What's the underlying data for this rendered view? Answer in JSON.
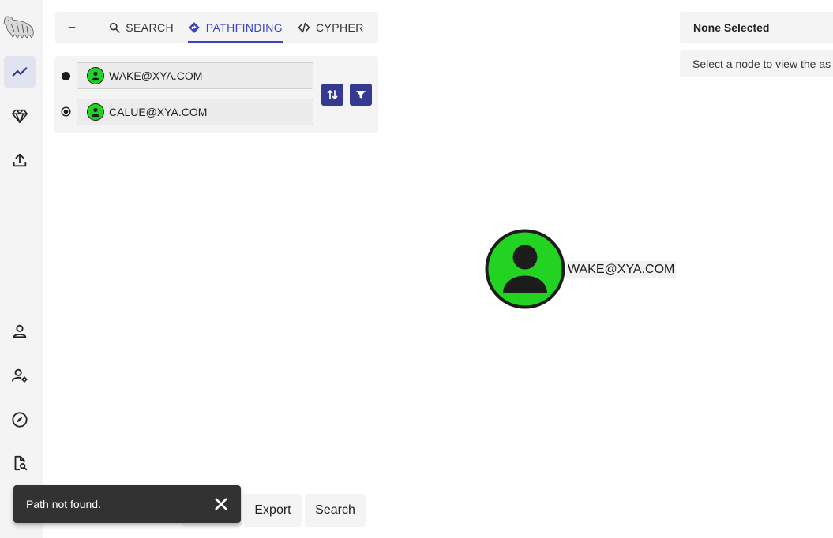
{
  "sidebar": {
    "items": [
      {
        "name": "explore",
        "icon": "trending-line-icon",
        "active": true
      },
      {
        "name": "group-management",
        "icon": "gem-icon",
        "active": false
      },
      {
        "name": "file-ingest",
        "icon": "upload-icon",
        "active": false
      },
      {
        "name": "profile",
        "icon": "person-icon",
        "active": false
      },
      {
        "name": "administration",
        "icon": "user-gear-icon",
        "active": false
      },
      {
        "name": "api-explorer",
        "icon": "compass-icon",
        "active": false
      },
      {
        "name": "documentation",
        "icon": "file-search-icon",
        "active": false
      }
    ]
  },
  "tabs": {
    "collapse_icon": "minus-icon",
    "items": [
      {
        "label": "SEARCH",
        "icon": "magnifier-icon",
        "active": false
      },
      {
        "label": "PATHFINDING",
        "icon": "directions-icon",
        "active": true
      },
      {
        "label": "CYPHER",
        "icon": "code-icon",
        "active": false
      }
    ]
  },
  "pathfinding": {
    "start_node": "WAKE@XYA.COM",
    "end_node": "CALUE@XYA.COM",
    "swap_icon": "swap-vertical-icon",
    "filter_icon": "filter-icon"
  },
  "info_panel": {
    "title": "None Selected",
    "message": "Select a node to view the as"
  },
  "graph": {
    "node_label": "WAKE@XYA.COM",
    "node_color": "#22d322"
  },
  "bottom_bar": {
    "export_label": "Export",
    "search_label": "Search"
  },
  "snackbar": {
    "message": "Path not found."
  },
  "colors": {
    "accent": "#3b45c4",
    "button": "#343a8f",
    "user_node": "#22d322"
  }
}
